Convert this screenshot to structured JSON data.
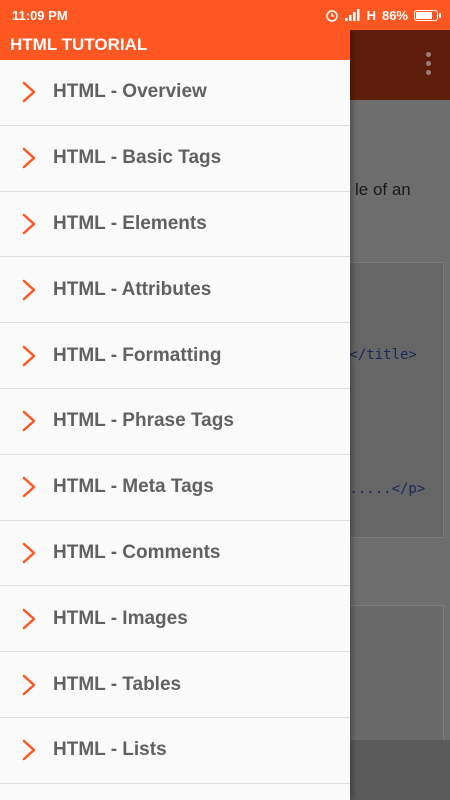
{
  "statusbar": {
    "time": "11:09 PM",
    "network": "H",
    "battery": "86%",
    "battery_level": 0.86
  },
  "drawer": {
    "title": "HTML TUTORIAL",
    "items": [
      {
        "label": "HTML - Overview"
      },
      {
        "label": "HTML - Basic Tags"
      },
      {
        "label": "HTML - Elements"
      },
      {
        "label": "HTML - Attributes"
      },
      {
        "label": "HTML - Formatting"
      },
      {
        "label": "HTML - Phrase Tags"
      },
      {
        "label": "HTML - Meta Tags"
      },
      {
        "label": "HTML - Comments"
      },
      {
        "label": "HTML - Images"
      },
      {
        "label": "HTML - Tables"
      },
      {
        "label": "HTML - Lists"
      }
    ]
  },
  "background": {
    "text_fragment": "le of an",
    "code_line_1": "e</title>",
    "code_line_2": "e.....</p>"
  },
  "colors": {
    "accent": "#ff5722",
    "toolbar_dim": "#5f1e0c",
    "chevron": "#ff5722",
    "label": "#616161"
  }
}
